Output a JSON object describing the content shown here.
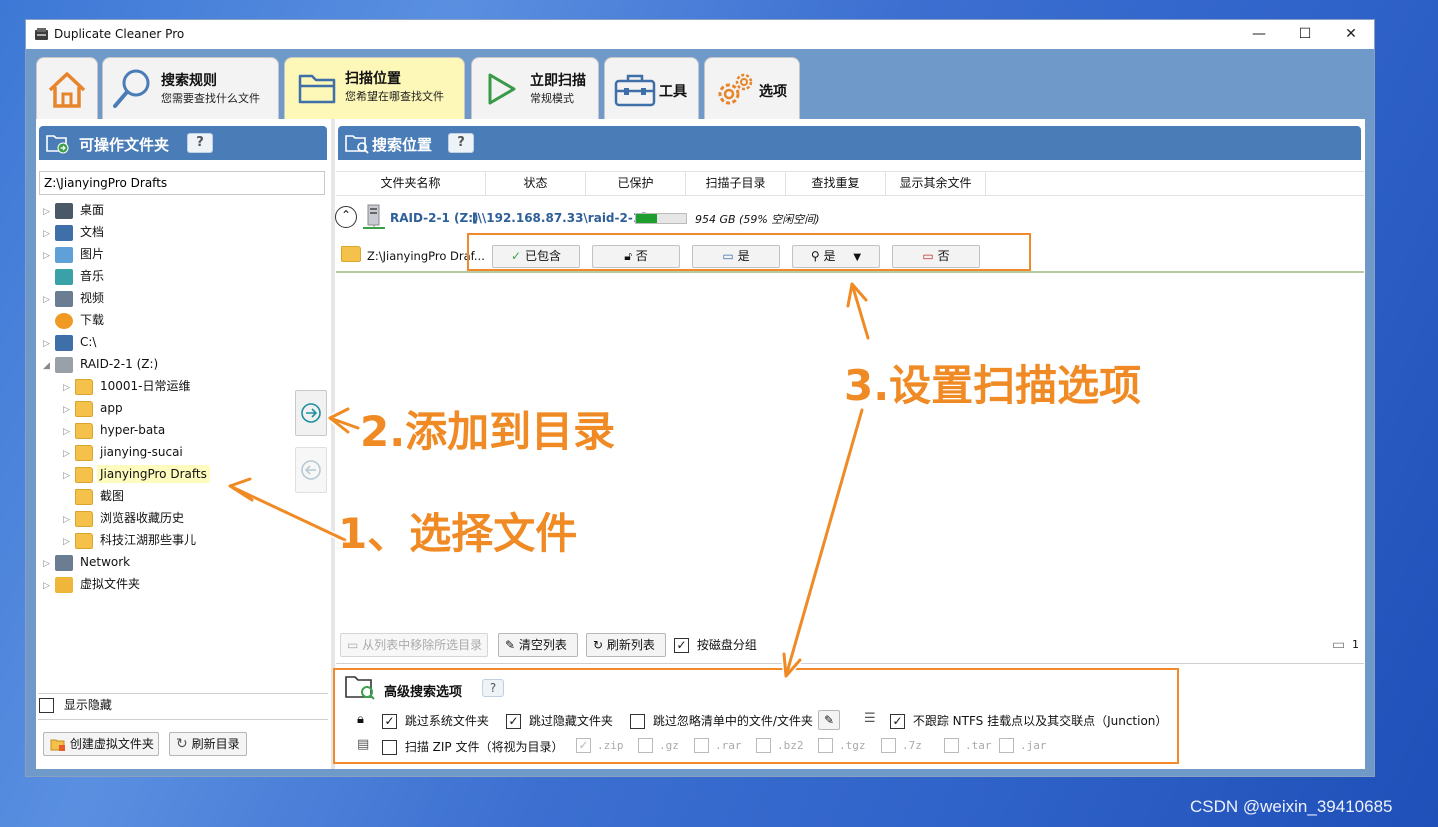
{
  "window": {
    "title": "Duplicate Cleaner Pro",
    "minimize": "—",
    "maximize": "☐",
    "close": "✕"
  },
  "ribbon": {
    "tabs": [
      {
        "id": "home",
        "icon": "house-icon"
      },
      {
        "id": "search-rules",
        "label": "搜索规则",
        "sub": "您需要查找什么文件",
        "icon": "magnifier-icon"
      },
      {
        "id": "scan-location",
        "label": "扫描位置",
        "sub": "您希望在哪查找文件",
        "icon": "folder-icon",
        "active": true
      },
      {
        "id": "scan-now",
        "label": "立即扫描",
        "sub": "常规模式",
        "icon": "play-icon"
      },
      {
        "id": "tools",
        "label": "工具",
        "icon": "toolbox-icon"
      },
      {
        "id": "options",
        "label": "选项",
        "icon": "gears-icon"
      }
    ]
  },
  "left_panel": {
    "title": "可操作文件夹",
    "help": "?",
    "path_value": "Z:\\JianyingPro Drafts",
    "tree": [
      {
        "label": "桌面",
        "level": 0,
        "arrow": "▷",
        "icon": "desktop"
      },
      {
        "label": "文档",
        "level": 0,
        "arrow": "▷",
        "icon": "doc"
      },
      {
        "label": "图片",
        "level": 0,
        "arrow": "▷",
        "icon": "picture"
      },
      {
        "label": "音乐",
        "level": 0,
        "arrow": "",
        "icon": "music"
      },
      {
        "label": "视频",
        "level": 0,
        "arrow": "▷",
        "icon": "video"
      },
      {
        "label": "下载",
        "level": 0,
        "arrow": "",
        "icon": "download"
      },
      {
        "label": "C:\\",
        "level": 0,
        "arrow": "▷",
        "icon": "drive"
      },
      {
        "label": "RAID-2-1 (Z:)",
        "level": 0,
        "arrow": "◢",
        "icon": "server"
      },
      {
        "label": "10001-日常运维",
        "level": 1,
        "arrow": "▷",
        "icon": "folder"
      },
      {
        "label": "app",
        "level": 1,
        "arrow": "▷",
        "icon": "folder"
      },
      {
        "label": "hyper-bata",
        "level": 1,
        "arrow": "▷",
        "icon": "folder"
      },
      {
        "label": "jianying-sucai",
        "level": 1,
        "arrow": "▷",
        "icon": "folder"
      },
      {
        "label": "JianyingPro Drafts",
        "level": 1,
        "arrow": "▷",
        "icon": "folder",
        "selected": true
      },
      {
        "label": "截图",
        "level": 1,
        "arrow": "",
        "icon": "folder"
      },
      {
        "label": "浏览器收藏历史",
        "level": 1,
        "arrow": "▷",
        "icon": "folder"
      },
      {
        "label": "科技江湖那些事儿",
        "level": 1,
        "arrow": "▷",
        "icon": "folder"
      },
      {
        "label": "Network",
        "level": 0,
        "arrow": "▷",
        "icon": "network"
      },
      {
        "label": "虚拟文件夹",
        "level": 0,
        "arrow": "▷",
        "icon": "virtual"
      }
    ],
    "show_hidden": "显示隐藏",
    "create_virtual": "创建虚拟文件夹",
    "refresh_dir": "刷新目录"
  },
  "middle": {
    "add_arrow": "→",
    "remove_arrow": "←"
  },
  "right_panel": {
    "title": "搜索位置",
    "help": "?",
    "columns": [
      "文件夹名称",
      "状态",
      "已保护",
      "扫描子目录",
      "查找重复",
      "显示其余文件"
    ],
    "drive": {
      "name": "RAID-2-1 (Z:)",
      "path": "[\\\\192.168.87.33\\raid-2-1]",
      "size": "954 GB (59% 空闲空间)",
      "used_percent": 41
    },
    "folder_row": {
      "name": "Z:\\JianyingPro Draf...",
      "status": "已包含",
      "protected": "否",
      "subdirs": "是",
      "find_dup": "是",
      "show_rest": "否"
    },
    "bottom_bar": {
      "remove_selected": "从列表中移除所选目录",
      "clear_list": "清空列表",
      "refresh_list": "刷新列表",
      "group_by_disk": "按磁盘分组",
      "count": "1"
    }
  },
  "advanced": {
    "title": "高级搜索选项",
    "help": "?",
    "skip_system": "跳过系统文件夹",
    "skip_hidden": "跳过隐藏文件夹",
    "skip_ignore": "跳过忽略清单中的文件/文件夹",
    "no_ntfs": "不跟踪 NTFS 挂载点以及其交联点（Junction）",
    "scan_zip": "扫描 ZIP 文件（将视为目录）",
    "archives": [
      ".zip",
      ".gz",
      ".rar",
      ".bz2",
      ".tgz",
      ".7z",
      ".tar",
      ".jar"
    ]
  },
  "annotations": {
    "step1": "1、选择文件",
    "step2": "2.添加到目录",
    "step3": "3.设置扫描选项"
  },
  "watermark": "CSDN @weixin_39410685",
  "colors": {
    "header_blue": "#4a7db7",
    "ribbon_blue": "#6f99c8",
    "active_tab": "#fdf7b8",
    "annotation_orange": "#f08a24",
    "progress_green": "#1e9e2f"
  }
}
